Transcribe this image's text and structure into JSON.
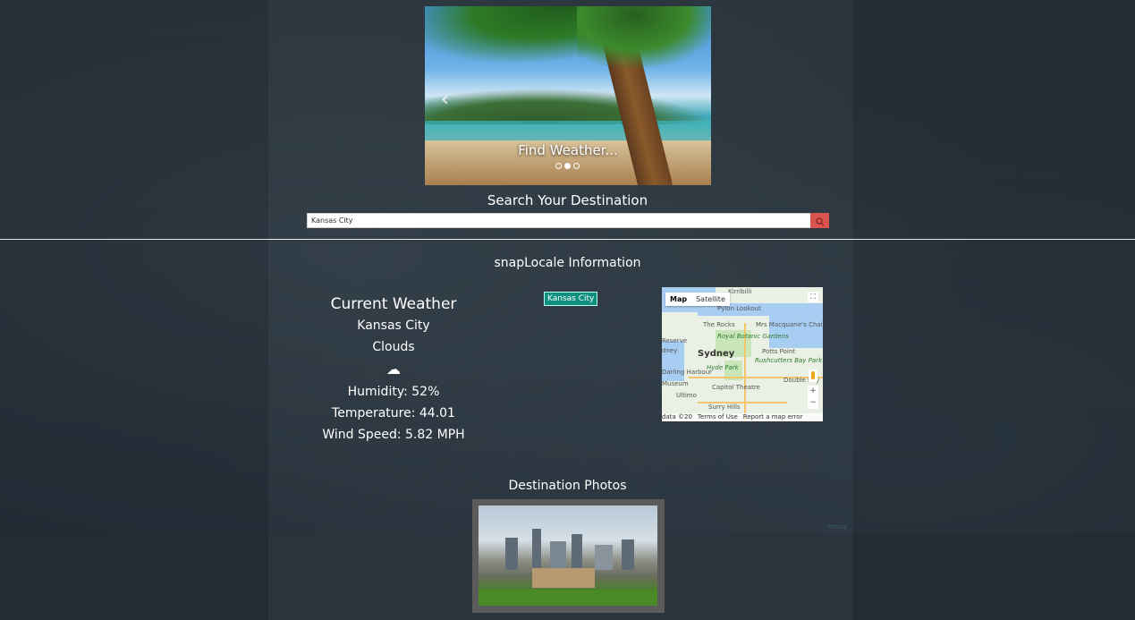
{
  "carousel": {
    "caption": "Find Weather...",
    "prev_glyph": "‹",
    "dot_count": 3,
    "active_dot": 1
  },
  "search": {
    "title": "Search Your Destination",
    "value": "Kansas City",
    "button_icon": "search-icon",
    "button_color": "#d9534f"
  },
  "info": {
    "title": "snapLocale Information"
  },
  "weather": {
    "title": "Current Weather",
    "city": "Kansas City",
    "condition": "Clouds",
    "icon": "cloud-icon",
    "icon_glyph": "☁",
    "humidity": "Humidity: 52%",
    "temperature": "Temperature: 44.01",
    "wind": "Wind Speed: 5.82 MPH"
  },
  "city_badge": {
    "label": "Kansas City",
    "color": "#0f8f7e"
  },
  "map": {
    "type_options": [
      "Map",
      "Satellite"
    ],
    "selected_type": "Map",
    "labels": {
      "city": "Sydney",
      "kirribilli": "Kirribilli",
      "pylon": "Pylon Lookout",
      "rocks": "The Rocks",
      "macquarie": "Mrs Macquarie's Chair",
      "botanic": "Royal Botanic Gardens",
      "potts": "Potts Point",
      "darling": "Darling Harbour",
      "hyde": "Hyde Park",
      "rushcutters": "Rushcutters Bay Park",
      "museum": "Museum",
      "capitol": "Capitol Theatre",
      "ultimo": "Ultimo",
      "surry": "Surry Hills",
      "double": "Double Bay",
      "reserve": "Reserve",
      "edney": "dney"
    },
    "footer": {
      "data": "data ©20",
      "terms": "Terms of Use",
      "report": "Report a map error"
    }
  },
  "photos": {
    "title": "Destination Photos"
  },
  "footer_link": "Imvoy"
}
